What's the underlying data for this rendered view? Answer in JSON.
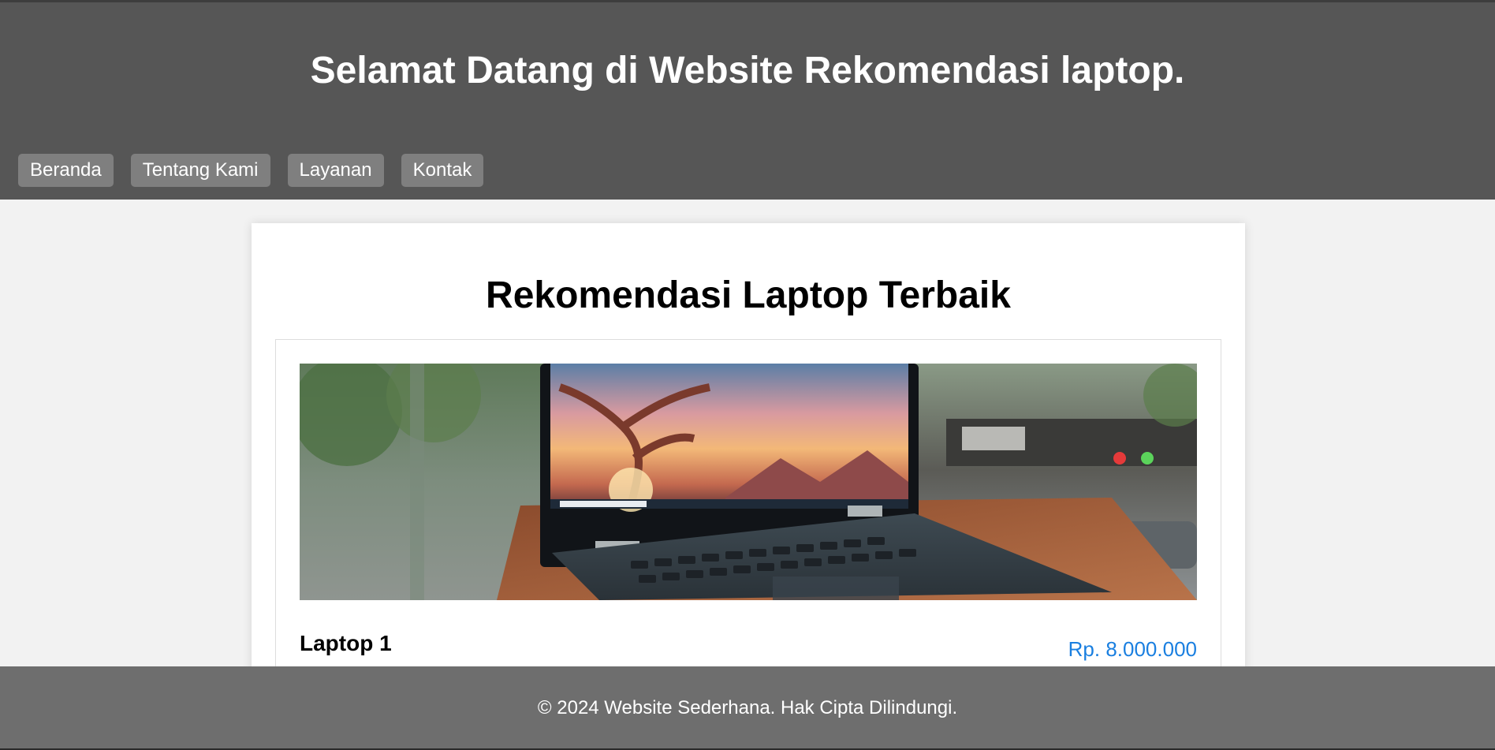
{
  "header": {
    "title": "Selamat Datang di Website Rekomendasi laptop."
  },
  "nav": {
    "items": [
      {
        "label": "Beranda"
      },
      {
        "label": "Tentang Kami"
      },
      {
        "label": "Layanan"
      },
      {
        "label": "Kontak"
      }
    ]
  },
  "main": {
    "heading": "Rekomendasi Laptop Terbaik",
    "products": [
      {
        "name": "Laptop 1",
        "price": "Rp. 8.000.000",
        "image_alt": "Dell laptop on wooden table by a window"
      }
    ]
  },
  "footer": {
    "text": "© 2024 Website Sederhana. Hak Cipta Dilindungi."
  },
  "colors": {
    "header_bg": "#565656",
    "nav_button_bg": "#7f7f7f",
    "footer_bg": "#6e6e6e",
    "price": "#1a7fe0",
    "page_bg": "#f2f2f2"
  }
}
